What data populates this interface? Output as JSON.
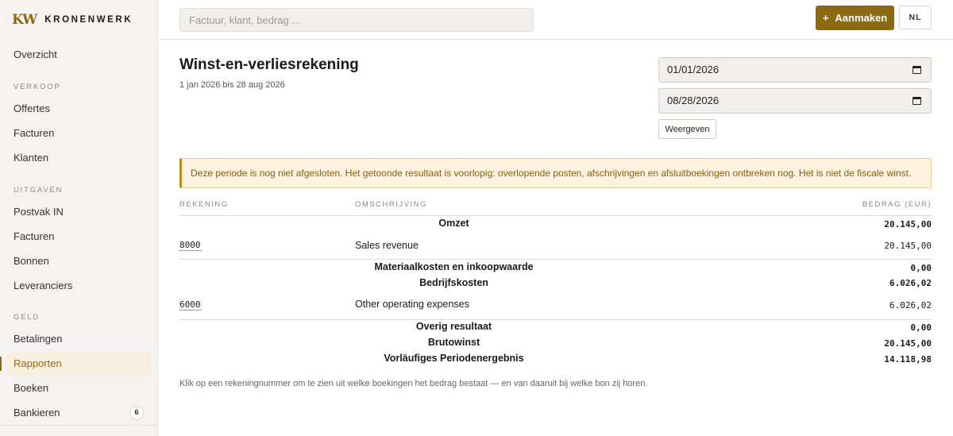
{
  "brand": {
    "logo": "KW",
    "name": "KRONENWERK"
  },
  "sidebar": {
    "overview": "Overzicht",
    "sections": {
      "sales": "VERKOOP",
      "expenses": "UITGAVEN",
      "money": "GELD"
    },
    "sales_items": [
      "Offertes",
      "Facturen",
      "Klanten"
    ],
    "expense_items": [
      "Postvak IN",
      "Facturen",
      "Bonnen",
      "Leveranciers"
    ],
    "money_items": [
      "Betalingen",
      "Rapporten",
      "Boeken",
      "Bankieren"
    ],
    "active": "Rapporten",
    "bank_badge": "6"
  },
  "topbar": {
    "search_placeholder": "Factuur, klant, bedrag ...",
    "create_plus": "+",
    "create_label": "Aanmaken",
    "lang": "NL"
  },
  "report": {
    "title": "Winst-en-verliesrekening",
    "period": "1 jan 2026 bis 28 aug 2026",
    "date_from": "01/01/2026",
    "date_to": "08/28/2026",
    "show_button": "Weergeven",
    "notice": "Deze periode is nog niet afgesloten. Het getoonde resultaat is voorlopig: overlopende posten, afschrijvingen en afsluitboekingen ontbreken nog. Het is niet de fiscale winst.",
    "columns": {
      "account": "REKENING",
      "description": "OMSCHRIJVING",
      "amount": "BEDRAG (EUR)"
    },
    "revenue": {
      "label": "Omzet",
      "total": "20.145,00"
    },
    "revenue_row": {
      "account": "8000",
      "description": "Sales revenue",
      "amount": "20.145,00"
    },
    "materials": {
      "label": "Materiaalkosten en inkoopwaarde",
      "total": "0,00"
    },
    "operating": {
      "label": "Bedrijfskosten",
      "total": "6.026,02"
    },
    "operating_row": {
      "account": "6000",
      "description": "Other operating expenses",
      "amount": "6.026,02"
    },
    "other": {
      "label": "Overig resultaat",
      "total": "0,00"
    },
    "gross": {
      "label": "Brutowinst",
      "total": "20.145,00"
    },
    "result": {
      "label": "Vorläufiges Periodenergebnis",
      "total": "14.118,98"
    },
    "footnote": "Klik op een rekeningnummer om te zien uit welke boekingen het bedrag bestaat — en van daaruit bij welke bon zij horen."
  },
  "colors": {
    "accent": "#8c6a12",
    "notice_bg": "#fdf3de",
    "active_bg": "#f9efdf"
  }
}
